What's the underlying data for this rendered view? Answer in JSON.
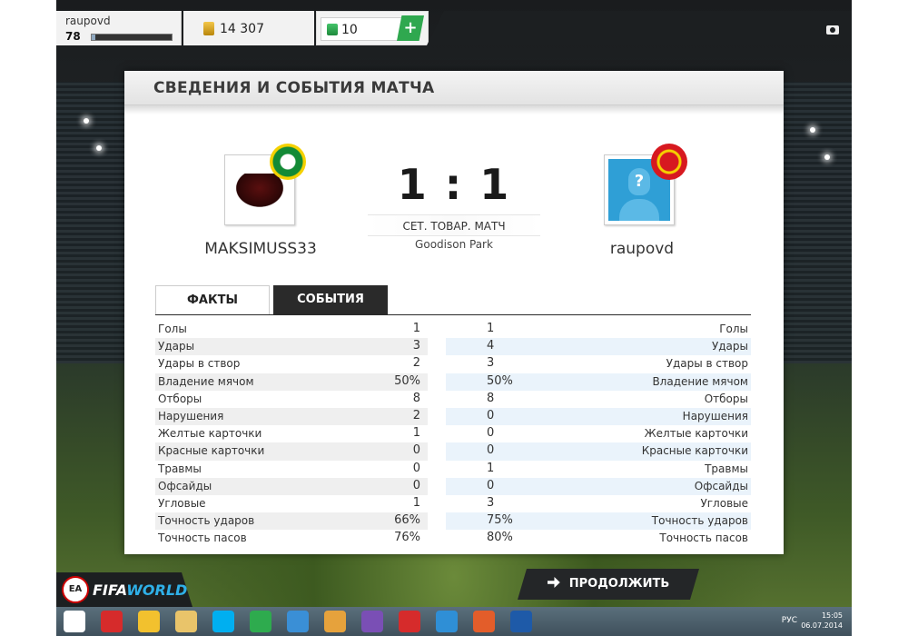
{
  "topbar": {
    "username": "raupovd",
    "level": "78",
    "xp_fraction": 0.05,
    "coins": "14 307",
    "points": "10",
    "plus": "+"
  },
  "panel": {
    "title": "СВЕДЕНИЯ И СОБЫТИЯ МАТЧА",
    "home_name": "MAKSIMUSS33",
    "away_name": "raupovd",
    "score": "1 : 1",
    "match_type": "СЕТ. ТОВАР. МАТЧ",
    "stadium": "Goodison Park",
    "avatar_mark": "?"
  },
  "tabs": {
    "facts": "ФАКТЫ",
    "events": "СОБЫТИЯ"
  },
  "stats": [
    {
      "label": "Голы",
      "home": "1",
      "away": "1"
    },
    {
      "label": "Удары",
      "home": "3",
      "away": "4"
    },
    {
      "label": "Удары в створ",
      "home": "2",
      "away": "3"
    },
    {
      "label": "Владение мячом",
      "home": "50%",
      "away": "50%"
    },
    {
      "label": "Отборы",
      "home": "8",
      "away": "8"
    },
    {
      "label": "Нарушения",
      "home": "2",
      "away": "0"
    },
    {
      "label": "Желтые карточки",
      "home": "1",
      "away": "0"
    },
    {
      "label": "Красные карточки",
      "home": "0",
      "away": "0"
    },
    {
      "label": "Травмы",
      "home": "0",
      "away": "1"
    },
    {
      "label": "Офсайды",
      "home": "0",
      "away": "0"
    },
    {
      "label": "Угловые",
      "home": "1",
      "away": "3"
    },
    {
      "label": "Точность ударов",
      "home": "66%",
      "away": "75%"
    },
    {
      "label": "Точность пасов",
      "home": "76%",
      "away": "80%"
    }
  ],
  "bottom": {
    "ea_label": "EA",
    "fifa_label": "FIFA",
    "world_label": "WORLD",
    "continue_label": "ПРОДОЛЖИТЬ"
  },
  "taskbar": {
    "lang": "РУС",
    "time": "15:05",
    "date": "06.07.2014",
    "icons": [
      "windows-icon",
      "yandex-icon",
      "chrome-icon",
      "explorer-icon",
      "skype-icon",
      "utorrent-icon",
      "itunes-icon",
      "game-icon",
      "vs-icon",
      "yandex-browser-icon",
      "audio-icon",
      "origin-icon",
      "fifaworld-icon"
    ],
    "icon_colors": [
      "#ffffff",
      "#d62b2b",
      "#f2c12e",
      "#e9c46a",
      "#00aff0",
      "#2eab4e",
      "#3a8fd6",
      "#e6a23c",
      "#7a4fb5",
      "#d62b2b",
      "#2f8fd6",
      "#e35d2a",
      "#1e5aa8"
    ]
  },
  "colors": {
    "accent_green": "#2fa84f",
    "dark_tab": "#2a2a2a"
  }
}
